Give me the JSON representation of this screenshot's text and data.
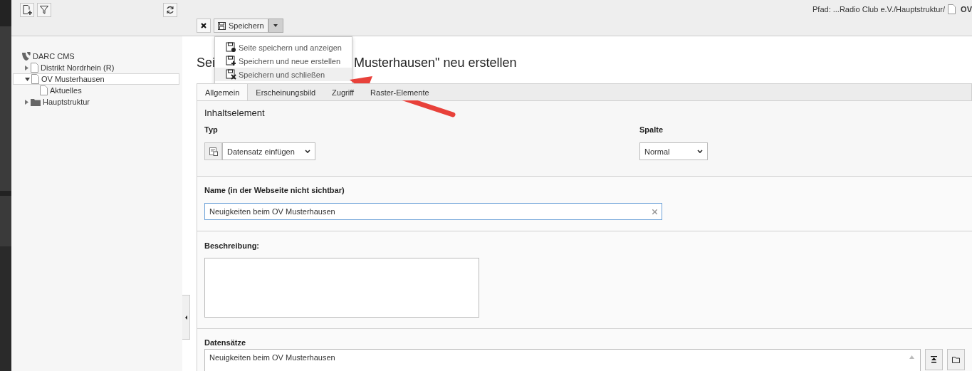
{
  "breadcrumb": {
    "path": "Pfad: ...Radio Club e.V./Hauptstruktur/",
    "current": "OV"
  },
  "page_tree": {
    "root": "DARC CMS",
    "items": [
      {
        "label": "Distrikt Nordrhein (R)",
        "kind": "page",
        "expanded": false,
        "selected": false
      },
      {
        "label": "OV Musterhausen",
        "kind": "page",
        "expanded": true,
        "selected": true,
        "children": [
          {
            "label": "Aktuelles",
            "kind": "page",
            "selected": false
          }
        ]
      },
      {
        "label": "Hauptstruktur",
        "kind": "folder",
        "expanded": false,
        "selected": false
      }
    ]
  },
  "doc_toolbar": {
    "save_button": "Speichern"
  },
  "save_menu": {
    "items": [
      {
        "label": "Seite speichern und anzeigen",
        "kind": "view",
        "selected": false
      },
      {
        "label": "Speichern und neue erstellen",
        "kind": "new",
        "selected": false
      },
      {
        "label": "Speichern und schließen",
        "kind": "close",
        "selected": true
      }
    ]
  },
  "title": {
    "start": "Sei",
    "end": "Musterhausen\" neu erstellen"
  },
  "tabs": [
    {
      "label": "Allgemein",
      "selected": true
    },
    {
      "label": "Erscheinungsbild",
      "selected": false
    },
    {
      "label": "Zugriff",
      "selected": false
    },
    {
      "label": "Raster-Elemente",
      "selected": false
    }
  ],
  "section_heading": "Inhaltselement",
  "type_field": {
    "label": "Typ",
    "value": "Datensatz einfügen"
  },
  "column_field": {
    "label": "Spalte",
    "value": "Normal"
  },
  "name_field": {
    "label": "Name (in der Webseite nicht sichtbar)",
    "value": "Neuigkeiten beim OV Musterhausen"
  },
  "description_field": {
    "label": "Beschreibung:"
  },
  "records_field": {
    "label": "Datensätze",
    "items": [
      "Neuigkeiten beim OV Musterhausen"
    ]
  }
}
